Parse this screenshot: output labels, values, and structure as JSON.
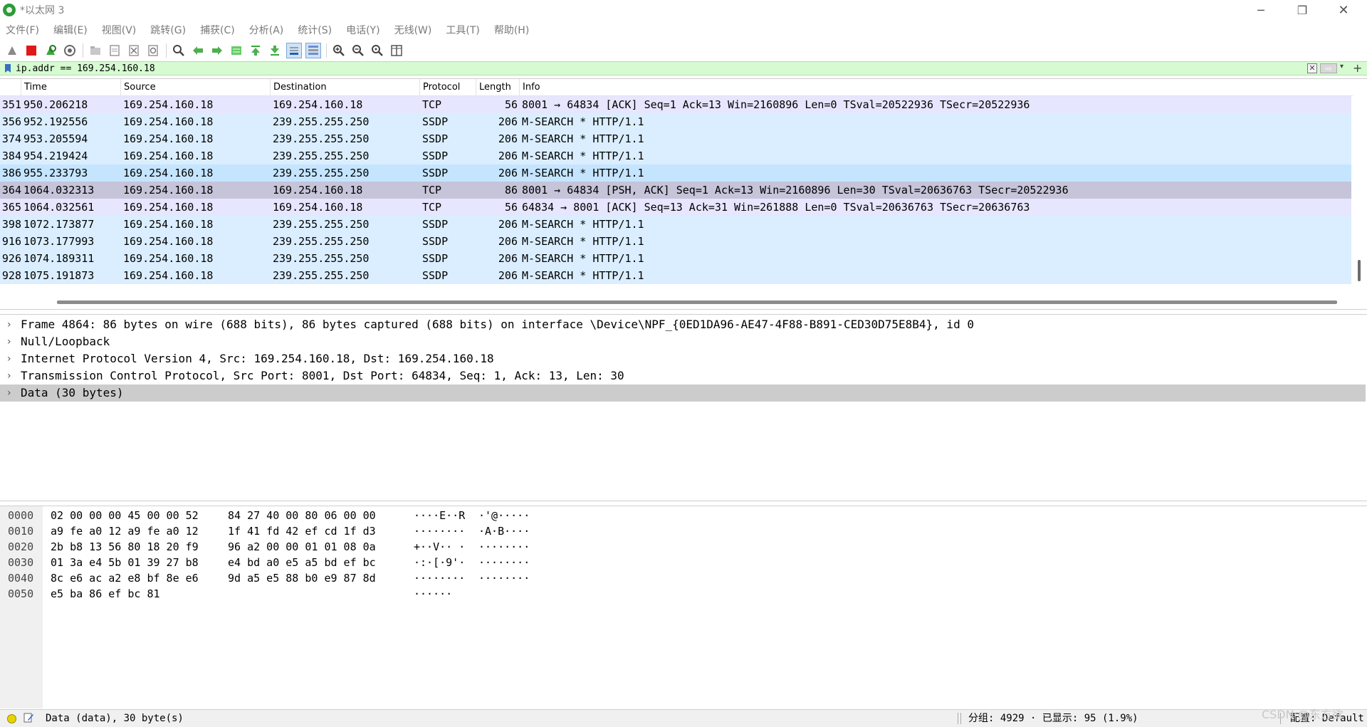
{
  "window": {
    "title": "*以太网 3",
    "min_glyph": "─",
    "max_glyph": "❐",
    "close_glyph": "✕"
  },
  "menu": [
    "文件(F)",
    "编辑(E)",
    "视图(V)",
    "跳转(G)",
    "捕获(C)",
    "分析(A)",
    "统计(S)",
    "电话(Y)",
    "无线(W)",
    "工具(T)",
    "帮助(H)"
  ],
  "filter": {
    "value": "ip.addr == 169.254.160.18",
    "clear_glyph": "✕",
    "apply_glyph": "⇨",
    "dropdown_glyph": "▾",
    "add_glyph": "+"
  },
  "packet_list": {
    "columns": [
      "Time",
      "Source",
      "Destination",
      "Protocol",
      "Length",
      "Info"
    ],
    "rows": [
      {
        "no": "351",
        "time": "950.206218",
        "src": "169.254.160.18",
        "dst": "169.254.160.18",
        "proto": "TCP",
        "len": "56",
        "info": "8001 → 64834 [ACK] Seq=1 Ack=13 Win=2160896 Len=0 TSval=20522936 TSecr=20522936",
        "bg": "#e7e6ff"
      },
      {
        "no": "356",
        "time": "952.192556",
        "src": "169.254.160.18",
        "dst": "239.255.255.250",
        "proto": "SSDP",
        "len": "206",
        "info": "M-SEARCH * HTTP/1.1",
        "bg": "#daeeff"
      },
      {
        "no": "374",
        "time": "953.205594",
        "src": "169.254.160.18",
        "dst": "239.255.255.250",
        "proto": "SSDP",
        "len": "206",
        "info": "M-SEARCH * HTTP/1.1",
        "bg": "#daeeff"
      },
      {
        "no": "384",
        "time": "954.219424",
        "src": "169.254.160.18",
        "dst": "239.255.255.250",
        "proto": "SSDP",
        "len": "206",
        "info": "M-SEARCH * HTTP/1.1",
        "bg": "#daeeff"
      },
      {
        "no": "386",
        "time": "955.233793",
        "src": "169.254.160.18",
        "dst": "239.255.255.250",
        "proto": "SSDP",
        "len": "206",
        "info": "M-SEARCH * HTTP/1.1",
        "bg": "#c5e5ff"
      },
      {
        "no": "364",
        "time": "1064.032313",
        "src": "169.254.160.18",
        "dst": "169.254.160.18",
        "proto": "TCP",
        "len": "86",
        "info": "8001 → 64834 [PSH, ACK] Seq=1 Ack=13 Win=2160896 Len=30 TSval=20636763 TSecr=20522936",
        "bg": "#c6c4d9"
      },
      {
        "no": "365",
        "time": "1064.032561",
        "src": "169.254.160.18",
        "dst": "169.254.160.18",
        "proto": "TCP",
        "len": "56",
        "info": "64834 → 8001 [ACK] Seq=13 Ack=31 Win=261888 Len=0 TSval=20636763 TSecr=20636763",
        "bg": "#e7e6ff"
      },
      {
        "no": "398",
        "time": "1072.173877",
        "src": "169.254.160.18",
        "dst": "239.255.255.250",
        "proto": "SSDP",
        "len": "206",
        "info": "M-SEARCH * HTTP/1.1",
        "bg": "#daeeff"
      },
      {
        "no": "916",
        "time": "1073.177993",
        "src": "169.254.160.18",
        "dst": "239.255.255.250",
        "proto": "SSDP",
        "len": "206",
        "info": "M-SEARCH * HTTP/1.1",
        "bg": "#daeeff"
      },
      {
        "no": "926",
        "time": "1074.189311",
        "src": "169.254.160.18",
        "dst": "239.255.255.250",
        "proto": "SSDP",
        "len": "206",
        "info": "M-SEARCH * HTTP/1.1",
        "bg": "#daeeff"
      },
      {
        "no": "928",
        "time": "1075.191873",
        "src": "169.254.160.18",
        "dst": "239.255.255.250",
        "proto": "SSDP",
        "len": "206",
        "info": "M-SEARCH * HTTP/1.1",
        "bg": "#daeeff"
      }
    ]
  },
  "details": {
    "selected_bg": "#cccccc",
    "items": [
      {
        "arrow": "›",
        "text": "Frame 4864: 86 bytes on wire (688 bits), 86 bytes captured (688 bits) on interface \\Device\\NPF_{0ED1DA96-AE47-4F88-B891-CED30D75E8B4}, id 0",
        "selected": false
      },
      {
        "arrow": "›",
        "text": "Null/Loopback",
        "selected": false
      },
      {
        "arrow": "›",
        "text": "Internet Protocol Version 4, Src: 169.254.160.18, Dst: 169.254.160.18",
        "selected": false
      },
      {
        "arrow": "›",
        "text": "Transmission Control Protocol, Src Port: 8001, Dst Port: 64834, Seq: 1, Ack: 13, Len: 30",
        "selected": false
      },
      {
        "arrow": "›",
        "text": "Data (30 bytes)",
        "selected": true
      }
    ]
  },
  "hex": {
    "rows": [
      {
        "offset": "0000",
        "hex1": "02 00 00 00 45 00 00 52",
        "hex2": "84 27 40 00 80 06 00 00",
        "ascii1": "····E··R",
        "ascii2": "·'@·····"
      },
      {
        "offset": "0010",
        "hex1": "a9 fe a0 12 a9 fe a0 12",
        "hex2": "1f 41 fd 42 ef cd 1f d3",
        "ascii1": "········",
        "ascii2": "·A·B····"
      },
      {
        "offset": "0020",
        "hex1": "2b b8 13 56 80 18 20 f9",
        "hex2": "96 a2 00 00 01 01 08 0a",
        "ascii1": "+··V·· ·",
        "ascii2": "········"
      },
      {
        "offset": "0030",
        "hex1": "01 3a e4 5b 01 39 27 b8",
        "hex2": "e4 bd a0 e5 a5 bd ef bc",
        "ascii1": "·:·[·9'·",
        "ascii2": "········"
      },
      {
        "offset": "0040",
        "hex1": "8c e6 ac a2 e8 bf 8e e6",
        "hex2": "9d a5 e5 88 b0 e9 87 8d",
        "ascii1": "········",
        "ascii2": "········"
      },
      {
        "offset": "0050",
        "hex1": "e5 ba 86 ef bc 81",
        "hex2": "",
        "ascii1": "······",
        "ascii2": ""
      }
    ]
  },
  "status": {
    "field_info": "Data (data), 30 byte(s)",
    "packets": "分组: 4929 · 已显示: 95 (1.9%)",
    "profile": "配置: Default"
  },
  "watermark": "CSDN @东方欲"
}
